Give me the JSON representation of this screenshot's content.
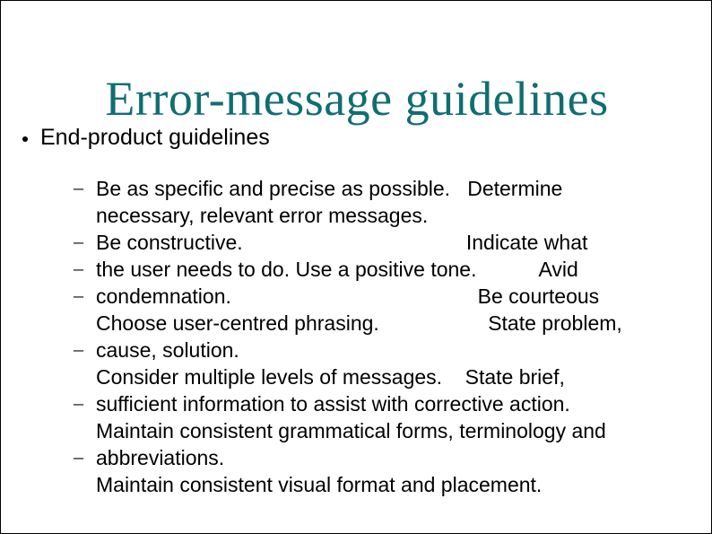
{
  "title": "Error-message guidelines",
  "bullet": "End-product guidelines",
  "sub": {
    "l1": "Be as specific and precise as possible.   Determine",
    "l2": "necessary, relevant error messages.",
    "l3": "Be constructive.                                       Indicate what",
    "l4": "the user needs to do. Use a positive tone.           Avid",
    "l5": "condemnation.                                           Be courteous",
    "l6": "Choose user-centred phrasing.                   State problem,",
    "l7": "cause, solution.",
    "l8": "Consider multiple levels of messages.    State brief,",
    "l9": "sufficient information to assist with corrective action.",
    "l10": "Maintain consistent grammatical forms, terminology and",
    "l11": "abbreviations.",
    "l12": "Maintain consistent visual format and placement."
  }
}
